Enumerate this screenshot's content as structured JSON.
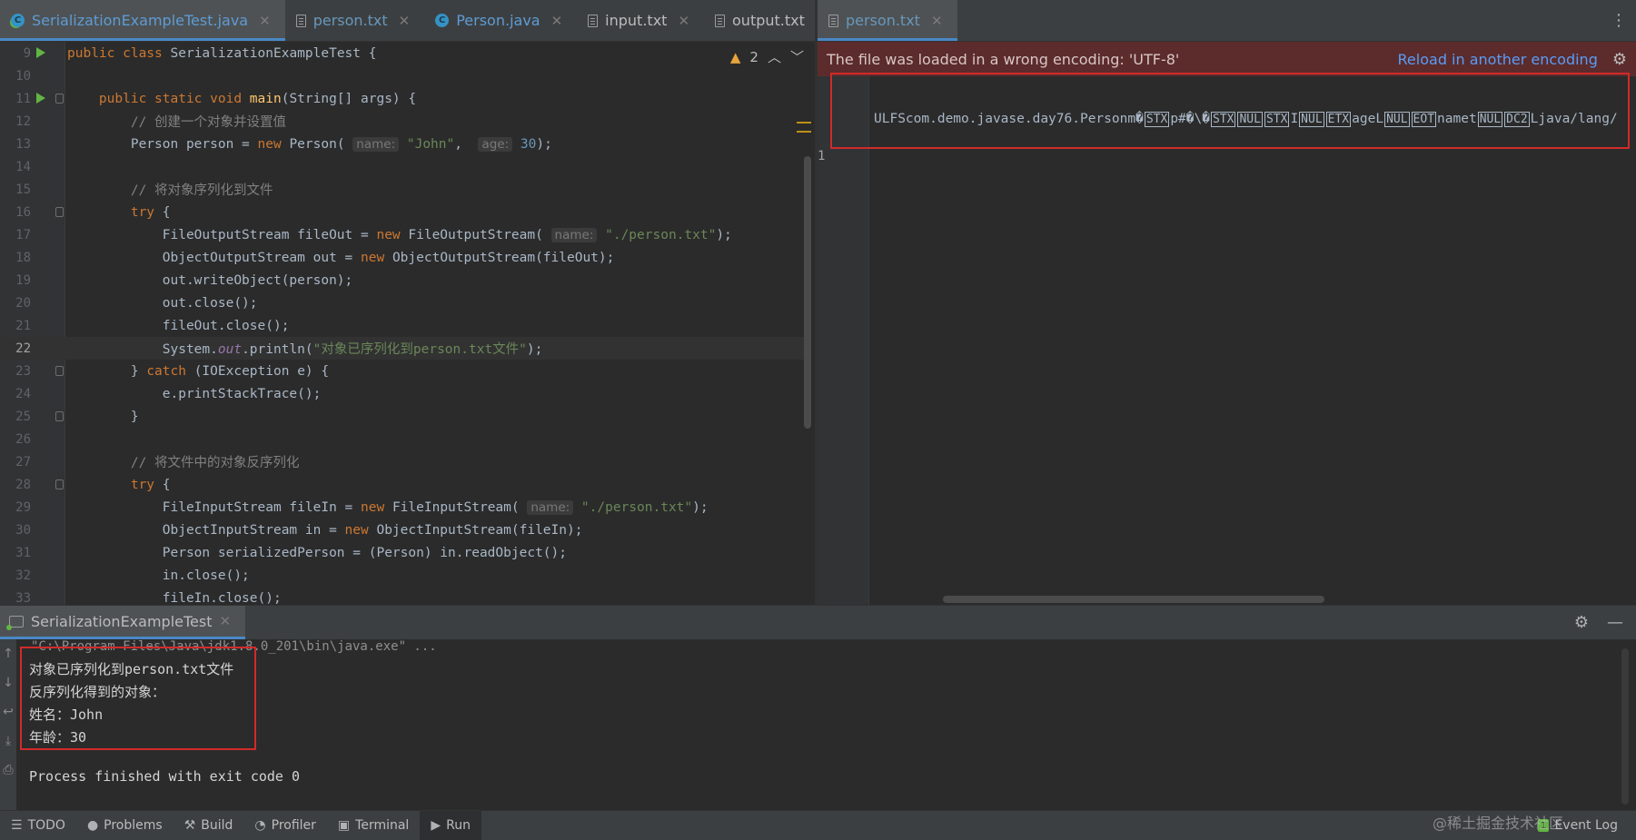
{
  "left_tabs": [
    {
      "label": "SerializationExampleTest.java",
      "icon": "java-class-run-icon",
      "active": true
    },
    {
      "label": "person.txt",
      "icon": "text-file-icon",
      "active": false
    },
    {
      "label": "Person.java",
      "icon": "java-class-icon",
      "active": false
    },
    {
      "label": "input.txt",
      "icon": "text-file-icon",
      "active": false
    },
    {
      "label": "output.txt",
      "icon": "text-file-icon",
      "active": false
    }
  ],
  "right_tabs": [
    {
      "label": "person.txt",
      "icon": "text-file-icon",
      "active": true
    }
  ],
  "editor": {
    "warning_count": "2",
    "line_numbers": [
      "9",
      "10",
      "11",
      "12",
      "13",
      "14",
      "15",
      "16",
      "17",
      "18",
      "19",
      "20",
      "21",
      "22",
      "23",
      "24",
      "25",
      "26",
      "27",
      "28",
      "29",
      "30",
      "31",
      "32",
      "33"
    ],
    "current_line": "22"
  },
  "encoding_banner": {
    "message": "The file was loaded in a wrong encoding: 'UTF-8'",
    "reload_label": "Reload in another encoding"
  },
  "right_editor": {
    "line_number": "1",
    "content_segments": [
      "ULFScom.demo.javase.day76.Personm",
      "�",
      "STX",
      "p#",
      "�",
      "\\",
      "�",
      "STX",
      "NUL",
      "STX",
      "I",
      "NUL",
      "ETX",
      "ageL",
      "NUL",
      "EOT",
      "namet",
      "NUL",
      "DC2",
      "Ljava/lang/"
    ]
  },
  "run_panel": {
    "tab_label": "SerializationExampleTest",
    "command": "\"C:\\Program Files\\Java\\jdk1.8.0_201\\bin\\java.exe\" ...",
    "output_lines": [
      "对象已序列化到person.txt文件",
      "反序列化得到的对象：",
      "姓名：John",
      "年龄：30"
    ],
    "exit_message": "Process finished with exit code 0"
  },
  "toolbar": [
    {
      "label": "TODO",
      "icon": "list-icon"
    },
    {
      "label": "Problems",
      "icon": "info-circle-icon"
    },
    {
      "label": "Build",
      "icon": "hammer-icon"
    },
    {
      "label": "Profiler",
      "icon": "profiler-icon"
    },
    {
      "label": "Terminal",
      "icon": "terminal-icon"
    },
    {
      "label": "Run",
      "icon": "play-icon",
      "active": true
    }
  ],
  "event_log": {
    "label": "Event Log",
    "badge": "1"
  },
  "watermark": "@稀土掘金技术社区",
  "colors": {
    "accent": "#4a88c7",
    "keyword": "#cc7832",
    "string": "#6a8759",
    "number": "#6897bb",
    "comment": "#808080",
    "method": "#ffc66d",
    "banner_bg": "#5c2b2c",
    "highlight_box": "#d12a2a"
  }
}
